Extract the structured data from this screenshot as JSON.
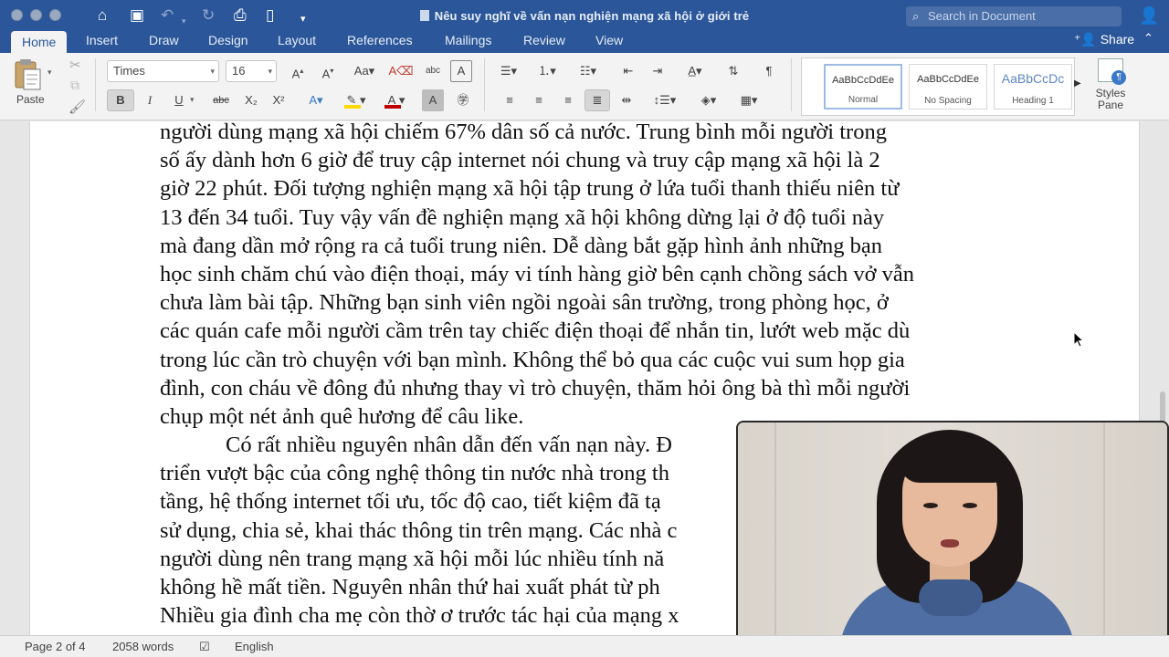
{
  "window": {
    "title": "Nêu suy nghĩ về vấn nạn nghiện mạng xã hội ở giới trẻ",
    "search_placeholder": "Search in Document",
    "share_label": "Share"
  },
  "tabs": [
    {
      "label": "Home",
      "active": true
    },
    {
      "label": "Insert"
    },
    {
      "label": "Draw"
    },
    {
      "label": "Design"
    },
    {
      "label": "Layout"
    },
    {
      "label": "References"
    },
    {
      "label": "Mailings"
    },
    {
      "label": "Review"
    },
    {
      "label": "View"
    }
  ],
  "ribbon": {
    "paste_label": "Paste",
    "font_name": "Times",
    "font_size": "16",
    "bold": "B",
    "italic": "I",
    "underline": "U",
    "strikethrough": "abc",
    "subscript": "X₂",
    "superscript": "X²",
    "styles": [
      {
        "sample": "AaBbCcDdEe",
        "name": "Normal",
        "selected": true
      },
      {
        "sample": "AaBbCcDdEe",
        "name": "No Spacing"
      },
      {
        "sample": "AaBbCcDc",
        "name": "Heading 1"
      }
    ],
    "styles_pane_label": "Styles Pane",
    "accent_color": "#2b579a",
    "highlight_color": "#ffd800",
    "font_color": "#c00000"
  },
  "document": {
    "paragraph1_lines": [
      "người dùng mạng xã hội chiếm 67% dân số cả nước. Trung bình mỗi người trong",
      "số ấy dành hơn 6 giờ để truy cập internet nói chung và truy cập mạng xã hội là 2",
      "giờ 22 phút. Đối tượng nghiện mạng xã hội tập trung ở lứa tuổi thanh thiếu niên từ",
      "13 đến 34 tuổi. Tuy vậy vấn đề nghiện mạng xã hội không dừng lại ở độ tuổi này",
      "mà đang dần mở rộng ra cả tuổi trung niên. Dễ dàng bắt gặp hình ảnh những bạn",
      "học sinh chăm chú vào điện thoại, máy vi tính hàng giờ bên cạnh chồng sách vở vẫn",
      "chưa làm bài tập. Những bạn sinh viên ngồi ngoài sân trường, trong phòng học, ở",
      "các quán cafe mỗi người cầm trên tay chiếc điện thoại để nhắn tin, lướt web mặc dù",
      "trong lúc cần trò chuyện với bạn mình. Không thể bỏ qua các cuộc vui sum họp gia",
      "đình, con cháu về đông đủ nhưng thay vì trò chuyện, thăm hỏi ông bà thì mỗi người",
      "chụp một nét ảnh quê hương để câu like."
    ],
    "paragraph2_lines": [
      "Có rất nhiều nguyên nhân dẫn đến vấn nạn này. Đ",
      "triển vượt bậc của công nghệ thông tin nước nhà trong th",
      "tầng, hệ thống internet tối ưu, tốc độ cao, tiết kiệm đã tạ",
      "sử dụng, chia sẻ, khai thác thông tin trên mạng. Các nhà c",
      "người dùng nên trang mạng xã hội mỗi lúc nhiều tính nă",
      "không hề mất tiền. Nguyên nhân thứ hai xuất phát từ ph",
      "Nhiều gia đình cha mẹ còn thờ ơ trước tác hại của mạng x"
    ]
  },
  "statusbar": {
    "page": "Page 2 of 4",
    "words": "2058 words",
    "language": "English"
  }
}
